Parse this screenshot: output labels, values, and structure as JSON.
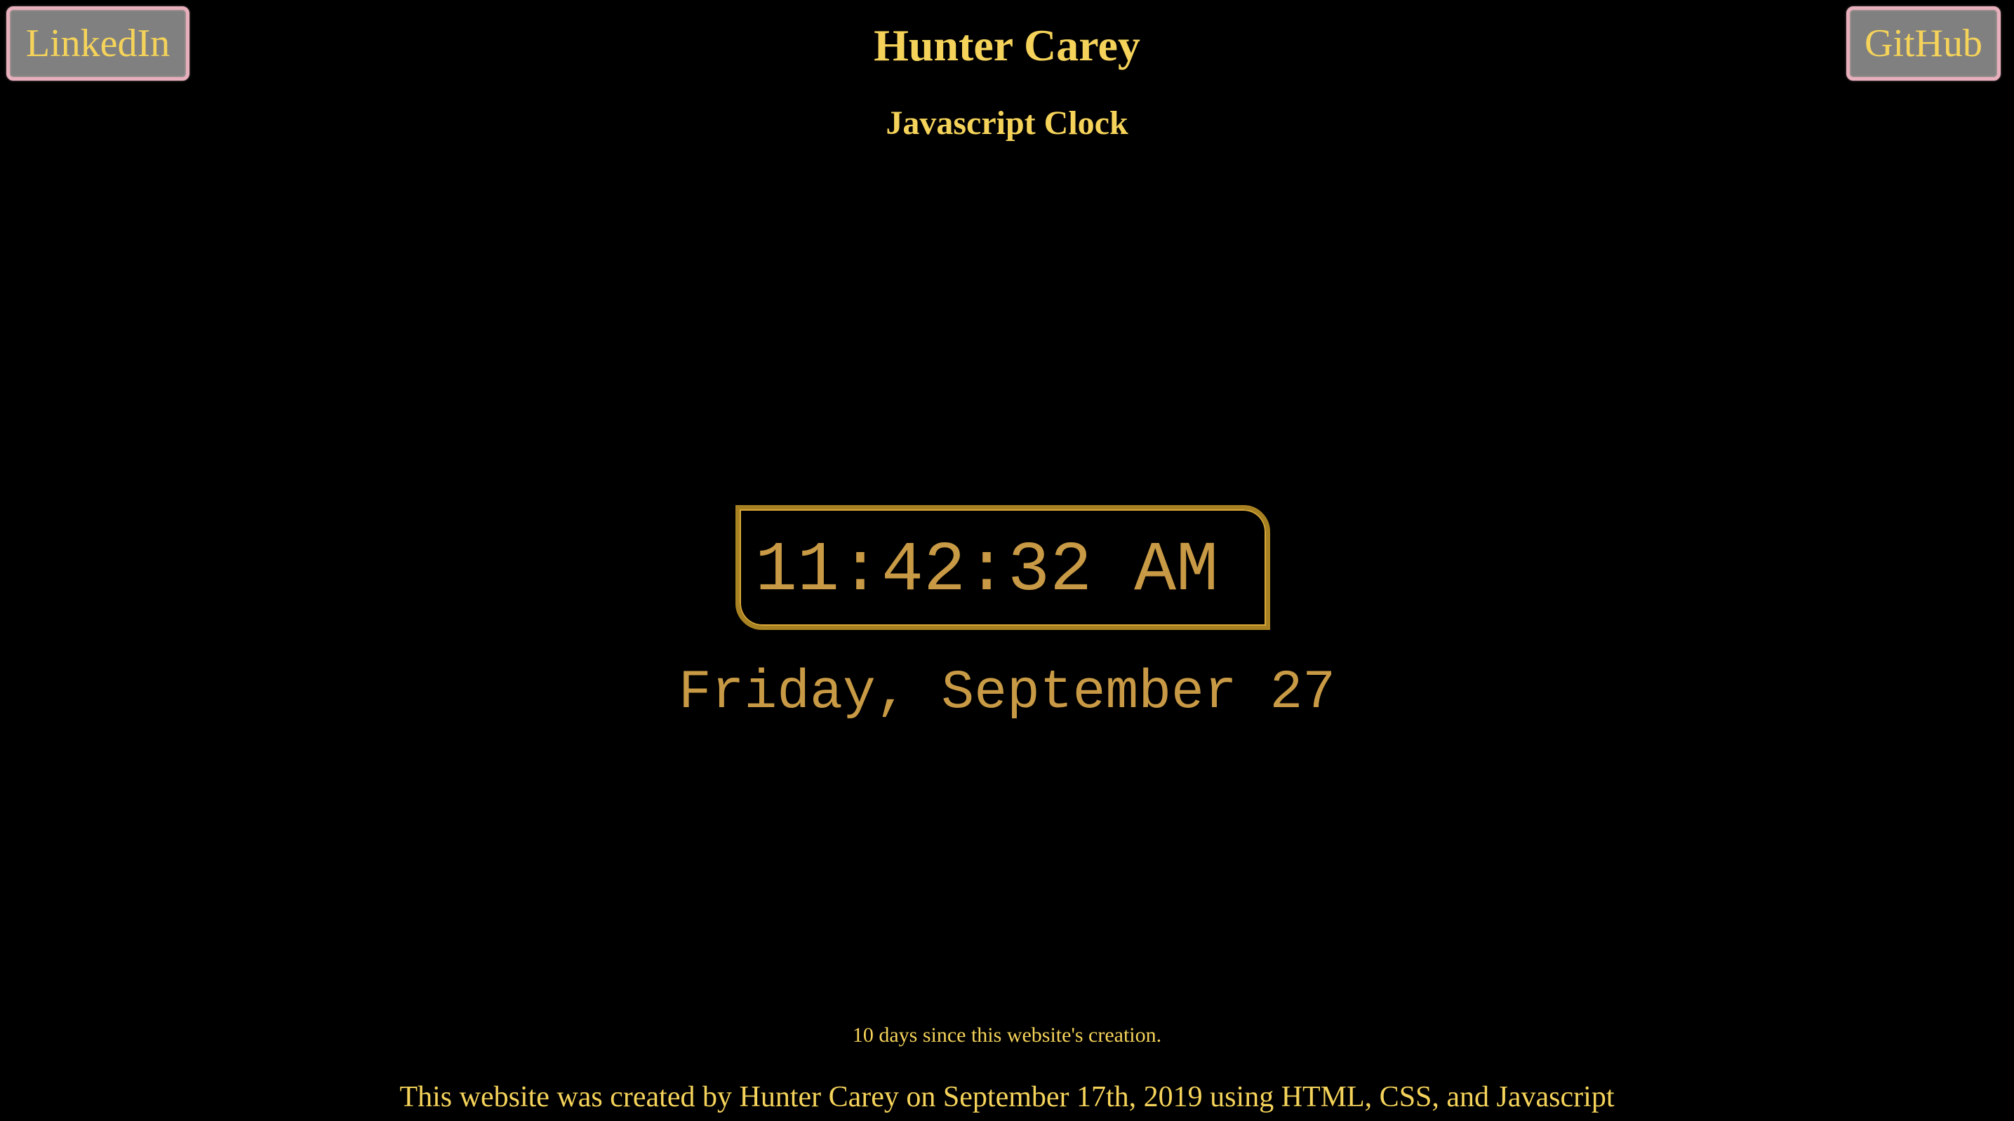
{
  "nav": {
    "linkedin_label": "LinkedIn",
    "github_label": "GitHub"
  },
  "header": {
    "title": "Hunter Carey",
    "subtitle": "Javascript Clock"
  },
  "clock": {
    "time": "11:42:32 AM",
    "date": "Friday, September 27"
  },
  "footer": {
    "days_since": "10 days since this website's creation.",
    "credit": "This website was created by Hunter Carey on September 17th, 2019 using HTML, CSS, and Javascript"
  },
  "colors": {
    "background": "#000000",
    "accent_yellow": "#f5d35a",
    "clock_gold": "#c99a45",
    "button_gray": "#808080",
    "button_border_pink": "#e8b0bc"
  }
}
